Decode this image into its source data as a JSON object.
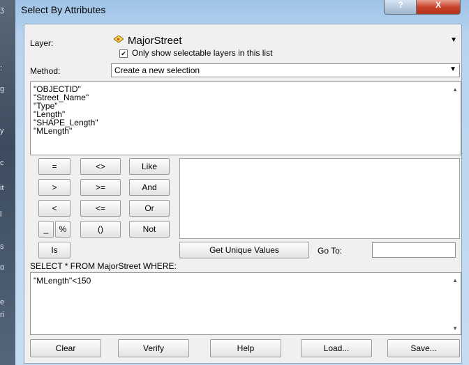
{
  "window": {
    "title": "Select By Attributes",
    "help_glyph": "?",
    "close_glyph": "X"
  },
  "layer": {
    "label": "Layer:",
    "value": "MajorStreet",
    "checkbox_label": "Only show selectable layers in this list",
    "checked": true
  },
  "method": {
    "label": "Method:",
    "value": "Create a new selection"
  },
  "fields": [
    "\"OBJECTID\"",
    "\"Street_Name\"",
    "\"Type\"",
    "\"Length\"",
    "\"SHAPE_Length\"",
    "\"MLength\""
  ],
  "operators": [
    "=",
    "<>",
    "Like",
    ">",
    ">=",
    "And",
    "<",
    "<=",
    "Or",
    "_",
    "%",
    "()",
    "Not",
    "Is"
  ],
  "unique_values_button": "Get Unique Values",
  "goto_label": "Go To:",
  "goto_value": "",
  "sql_prefix": "SELECT * FROM MajorStreet WHERE:",
  "expression": "\"MLength\"<150",
  "actions": {
    "clear": "Clear",
    "verify": "Verify",
    "help": "Help",
    "load": "Load...",
    "save": "Save..."
  },
  "background_marks": [
    "ʒ",
    ":",
    "g",
    "y",
    "c",
    "it",
    "l",
    "s",
    "ɑ",
    "e",
    "ri"
  ],
  "colors": {
    "title_bar": "#b7d3ef",
    "close_button": "#c8442c",
    "dialog_bg": "#f0f0f0"
  }
}
